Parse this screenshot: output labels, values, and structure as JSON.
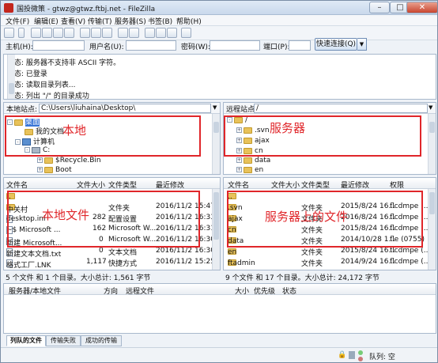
{
  "window": {
    "title": "国投微策 - gtwz@gtwz.ftbj.net - FileZilla",
    "minimize": "–",
    "maximize": "□",
    "close": "✕"
  },
  "menu": [
    "文件(F)",
    "编辑(E)",
    "查看(V)",
    "传输(T)",
    "服务器(S)",
    "书签(B)",
    "帮助(H)"
  ],
  "quickconnect": {
    "host_label": "主机(H):",
    "user_label": "用户名(U):",
    "pass_label": "密码(W):",
    "port_label": "端口(P):",
    "connect_label": "快速连接(Q)",
    "dropdown": "▼"
  },
  "log": [
    "状态: 服务器不支持非 ASCII 字符。",
    "状态: 已登录",
    "状态: 读取目录列表...",
    "状态: 列出 \"/\" 的目录成功"
  ],
  "local": {
    "site_label": "本地站点:",
    "path": "C:\\Users\\liuhaina\\Desktop\\",
    "tree": [
      {
        "label": "桌面",
        "icon": "folder-icon",
        "expander": "-"
      },
      {
        "label": "我的文档",
        "icon": "folder-icon",
        "expander": ""
      },
      {
        "label": "计算机",
        "icon": "computer-icon",
        "expander": "-"
      },
      {
        "label": "C:",
        "icon": "drive-icon",
        "expander": "-"
      },
      {
        "label": "$Recycle.Bin",
        "icon": "folder-icon",
        "expander": "+"
      },
      {
        "label": "Boot",
        "icon": "folder-icon",
        "expander": "+"
      }
    ],
    "columns": [
      "文件名",
      "文件大小",
      "文件类型",
      "最近修改"
    ],
    "files": [
      {
        "name": "..",
        "size": "",
        "type": "",
        "modified": "",
        "icon": "folder-icon"
      },
      {
        "name": "中关村",
        "size": "",
        "type": "文件夹",
        "modified": "2016/11/2 15:47...",
        "icon": "folder-icon"
      },
      {
        "name": "desktop.ini",
        "size": "282",
        "type": "配置设置",
        "modified": "2016/11/2 16:33...",
        "icon": "file-icon"
      },
      {
        "name": "~$ Microsoft ...",
        "size": "162",
        "type": "Microsoft W...",
        "modified": "2016/11/2 16:31...",
        "icon": "file-icon"
      },
      {
        "name": "新建 Microsoft...",
        "size": "0",
        "type": "Microsoft W...",
        "modified": "2016/11/2 16:30...",
        "icon": "file-icon"
      },
      {
        "name": "新建文本文档.txt",
        "size": "0",
        "type": "文本文档",
        "modified": "2016/11/2 16:30...",
        "icon": "file-icon"
      },
      {
        "name": "格式工厂.LNK",
        "size": "1,117",
        "type": "快捷方式",
        "modified": "2016/11/2 15:25...",
        "icon": "file-icon"
      }
    ],
    "status": "5 个文件 和 1 个目录。大小总计: 1,561 字节"
  },
  "remote": {
    "site_label": "远程站点:",
    "path": "/",
    "tree": [
      {
        "label": "/",
        "icon": "folder-icon",
        "expander": "-"
      },
      {
        "label": ".svn",
        "icon": "folder-icon",
        "expander": "+"
      },
      {
        "label": "ajax",
        "icon": "folder-icon",
        "expander": "+"
      },
      {
        "label": "cn",
        "icon": "folder-icon",
        "expander": "+"
      },
      {
        "label": "data",
        "icon": "folder-icon",
        "expander": "+"
      },
      {
        "label": "en",
        "icon": "folder-icon",
        "expander": "+"
      }
    ],
    "columns": [
      "文件名",
      "文件大小",
      "文件类型",
      "最近修改",
      "权限"
    ],
    "files": [
      {
        "name": "..",
        "size": "",
        "type": "",
        "modified": "",
        "perm": "",
        "icon": "folder-icon"
      },
      {
        "name": ".svn",
        "size": "",
        "type": "文件夹",
        "modified": "2015/8/24 16...",
        "perm": "flcdmpe (...",
        "icon": "folder-icon"
      },
      {
        "name": "ajax",
        "size": "",
        "type": "文件夹",
        "modified": "2016/8/24 16...",
        "perm": "flcdmpe (...",
        "icon": "folder-icon"
      },
      {
        "name": "cn",
        "size": "",
        "type": "文件夹",
        "modified": "2015/8/24 16...",
        "perm": "flcdmpe (...",
        "icon": "folder-icon"
      },
      {
        "name": "data",
        "size": "",
        "type": "文件夹",
        "modified": "2014/10/28 1...",
        "perm": "fle (0755)",
        "icon": "folder-icon"
      },
      {
        "name": "en",
        "size": "",
        "type": "文件夹",
        "modified": "2015/8/24 16...",
        "perm": "flcdmpe (...",
        "icon": "folder-icon"
      },
      {
        "name": "ftadmin",
        "size": "",
        "type": "文件夹",
        "modified": "2014/9/24 16...",
        "perm": "flcdmpe (...",
        "icon": "folder-icon"
      }
    ],
    "status": "9 个文件 和 17 个目录。大小总计: 24,172 字节"
  },
  "queue": {
    "columns": [
      "服务器/本地文件",
      "方向",
      "远程文件",
      "大小",
      "优先级",
      "状态"
    ]
  },
  "tabs": [
    "列队的文件",
    "传输失败",
    "成功的传输"
  ],
  "statusbar": {
    "queue_label": "队列: 空"
  },
  "annotations": {
    "local": "本地",
    "server": "服务器",
    "local_files": "本地文件",
    "server_files": "服务器上的文件",
    "color": "#e0262a"
  }
}
